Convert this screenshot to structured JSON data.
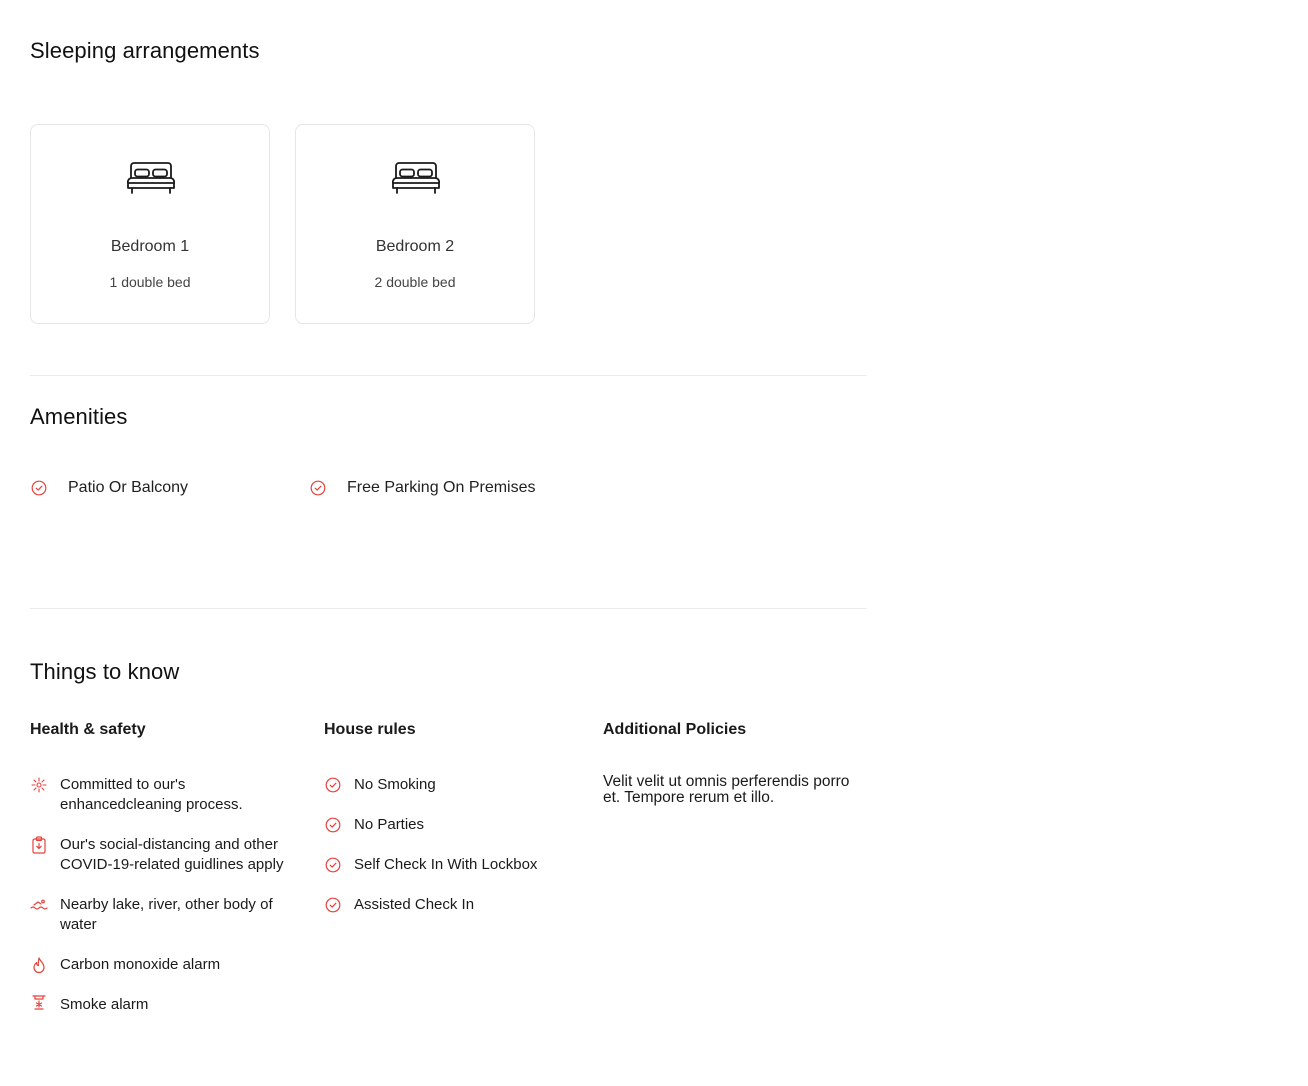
{
  "sleeping": {
    "title": "Sleeping arrangements",
    "bedrooms": [
      {
        "name": "Bedroom 1",
        "detail": "1 double bed"
      },
      {
        "name": "Bedroom 2",
        "detail": "2 double bed"
      }
    ]
  },
  "amenities": {
    "title": "Amenities",
    "items": [
      "Patio Or Balcony",
      "Free Parking On Premises"
    ]
  },
  "things": {
    "title": "Things to know",
    "health": {
      "heading": "Health & safety",
      "items": [
        {
          "icon": "sparkle-icon",
          "text": "Committed to our's enhancedcleaning process."
        },
        {
          "icon": "clipboard-icon",
          "text": "Our's social-distancing and other COVID-19-related guidlines apply"
        },
        {
          "icon": "water-icon",
          "text": "Nearby lake, river, other body of water"
        },
        {
          "icon": "flame-icon",
          "text": "Carbon monoxide alarm"
        },
        {
          "icon": "smoke-alarm-icon",
          "text": "Smoke alarm"
        }
      ]
    },
    "house_rules": {
      "heading": "House rules",
      "items": [
        "No Smoking",
        "No Parties",
        "Self Check In With Lockbox",
        "Assisted Check In"
      ]
    },
    "policies": {
      "heading": "Additional Policies",
      "text": "Velit velit ut omnis perferendis porro et. Tempore rerum et illo."
    }
  },
  "colors": {
    "accent": "#e8413c",
    "border": "#e6e6e6",
    "divider": "#ececec"
  }
}
